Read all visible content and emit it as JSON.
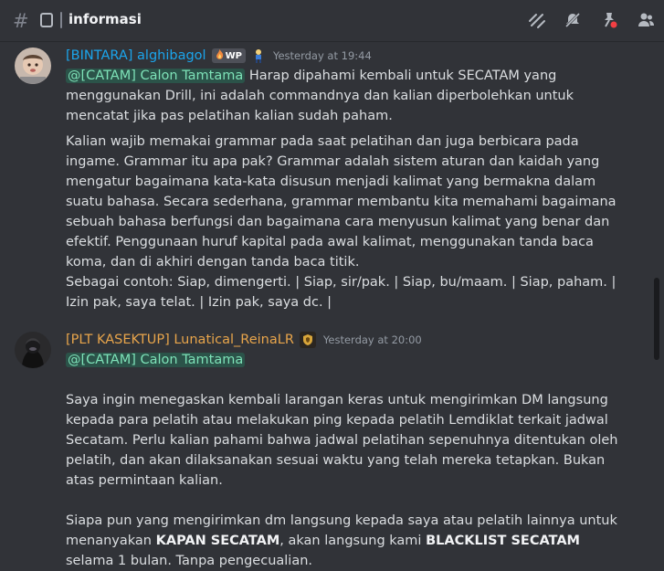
{
  "channel": {
    "name": "informasi"
  },
  "header_icons": [
    "threads-icon",
    "mute-icon",
    "pin-icon",
    "member-list-icon"
  ],
  "messages": [
    {
      "author": "[BINTARA] alghibagol",
      "author_color": "#1ba5ec",
      "badge": "WP",
      "badge_icon": "fire-icon",
      "extra_icon": "character-icon",
      "timestamp": "Yesterday at 19:44",
      "mention": "@[CATAM] Calon Tamtama",
      "p1": " Harap dipahami kembali untuk SECATAM yang menggunakan Drill, ini adalah commandnya dan kalian diperbolehkan untuk mencatat jika pas pelatihan kalian sudah paham.",
      "p2": "Kalian wajib memakai grammar pada saat pelatihan dan juga berbicara pada ingame. Grammar itu apa pak? Grammar adalah sistem aturan dan kaidah yang mengatur bagaimana kata-kata disusun menjadi kalimat yang bermakna dalam suatu bahasa. Secara sederhana, grammar membantu kita memahami bagaimana sebuah bahasa berfungsi dan bagaimana cara menyusun kalimat yang benar dan efektif. Penggunaan huruf kapital pada awal kalimat, menggunakan tanda baca koma, dan di akhiri dengan tanda baca titik.",
      "p3": "Sebagai contoh: Siap, dimengerti. | Siap, sir/pak. | Siap, bu/maam. | Siap, paham. | Izin pak, saya telat. | Izin pak, saya dc. |"
    },
    {
      "author": "[PLT KASEKTUP] Lunatical_ReinaLR",
      "author_color": "#e8a54b",
      "extra_icon": "shield-badge-icon",
      "timestamp": "Yesterday at 20:00",
      "mention": "@[CATAM] Calon Tamtama",
      "p1": "Saya ingin menegaskan kembali larangan keras untuk mengirimkan DM langsung kepada para pelatih atau melakukan ping kepada pelatih Lemdiklat terkait jadwal Secatam. Perlu kalian pahami bahwa jadwal pelatihan sepenuhnya ditentukan oleh pelatih, dan akan dilaksanakan sesuai waktu yang telah mereka tetapkan. Bukan atas permintaan kalian.",
      "p2a": "Siapa pun yang mengirimkan dm langsung kepada saya atau pelatih lainnya untuk menanyakan ",
      "p2b": "KAPAN SECATAM",
      "p2c": ", akan langsung kami ",
      "p2d": "BLACKLIST SECATAM",
      "p2e": " selama 1 bulan. Tanpa pengecualian."
    }
  ]
}
